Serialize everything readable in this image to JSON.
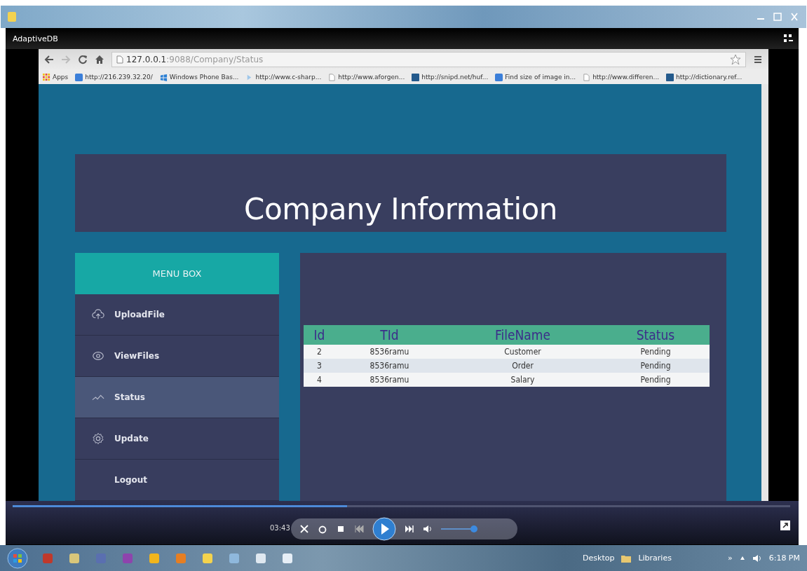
{
  "player_window": {
    "title": "AdaptiveDB"
  },
  "browser": {
    "url_host": "127.0.0.1",
    "url_path": ":9088/Company/Status",
    "bookmarks": [
      {
        "label": "Apps",
        "kind": "apps"
      },
      {
        "label": "http://216.239.32.20/",
        "kind": "blue"
      },
      {
        "label": "Windows Phone Bas...",
        "kind": "windows"
      },
      {
        "label": "http://www.c-sharp...",
        "kind": "light"
      },
      {
        "label": "http://www.aforgen...",
        "kind": "page"
      },
      {
        "label": "http://snipd.net/huf...",
        "kind": "navy"
      },
      {
        "label": "Find size of image in...",
        "kind": "blue"
      },
      {
        "label": "http://www.differen...",
        "kind": "page"
      },
      {
        "label": "http://dictionary.ref...",
        "kind": "navy"
      }
    ]
  },
  "page": {
    "title": "Company Information",
    "menu": {
      "title": "MENU BOX",
      "items": [
        {
          "label": "UploadFile",
          "kind": "upload",
          "selected": false
        },
        {
          "label": "ViewFiles",
          "kind": "view",
          "selected": false
        },
        {
          "label": "Status",
          "kind": "status",
          "selected": true
        },
        {
          "label": "Update",
          "kind": "update",
          "selected": false
        },
        {
          "label": "Logout",
          "kind": "plain",
          "selected": false
        }
      ]
    },
    "table": {
      "columns": [
        "Id",
        "TId",
        "FileName",
        "Status"
      ],
      "rows": [
        [
          "2",
          "8536ramu",
          "Customer",
          "Pending"
        ],
        [
          "3",
          "8536ramu",
          "Order",
          "Pending"
        ],
        [
          "4",
          "8536ramu",
          "Salary",
          "Pending"
        ]
      ]
    }
  },
  "player_controls": {
    "time": "03:43",
    "progress": {
      "level": 0.43
    },
    "volume": {
      "level": 0.9
    }
  },
  "taskbar": {
    "toolbar": "Desktop",
    "library": "Libraries",
    "overflow": "»",
    "clock": "6:18 PM"
  }
}
